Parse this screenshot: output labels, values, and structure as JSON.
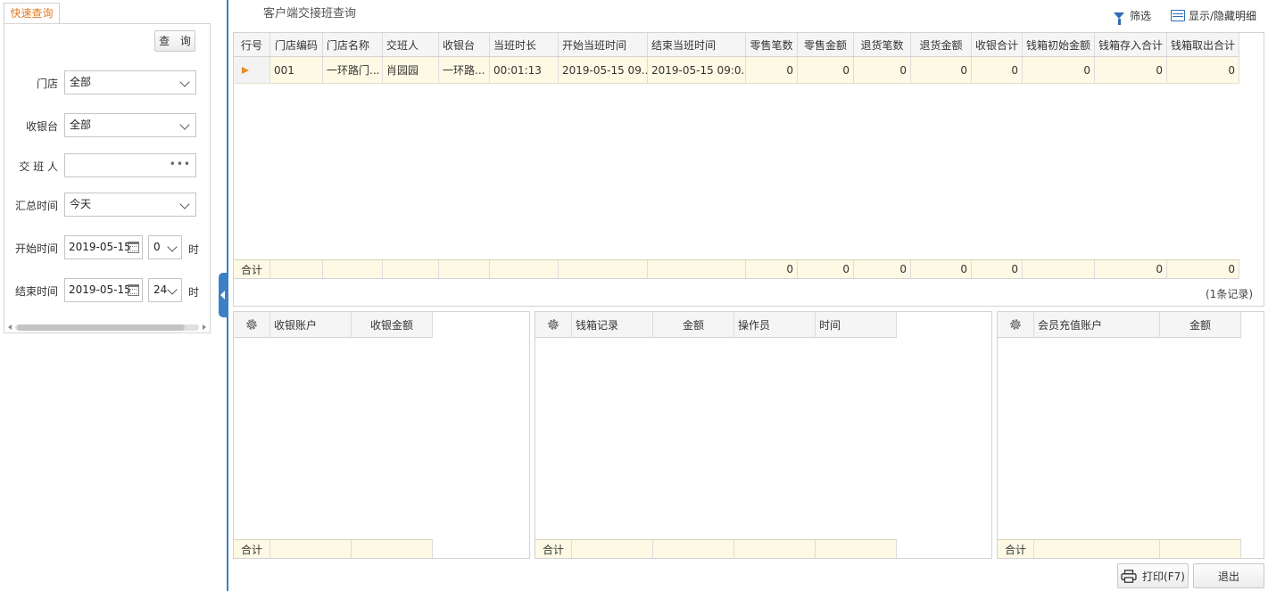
{
  "quick_query": {
    "tab_label": "快速查询",
    "query_button": "查 询",
    "store": {
      "label": "门店",
      "value": "全部"
    },
    "register": {
      "label": "收银台",
      "value": "全部"
    },
    "handover_person": {
      "label": "交 班 人",
      "value": ""
    },
    "summary_time": {
      "label": "汇总时间",
      "value": "今天"
    },
    "start_time": {
      "label": "开始时间",
      "date": "2019-05-15",
      "hour": "0",
      "unit": "时"
    },
    "end_time": {
      "label": "结束时间",
      "date": "2019-05-15",
      "hour": "24",
      "unit": "时"
    }
  },
  "header": {
    "title": "客户端交接班查询",
    "filter_label": "筛选",
    "toggle_label": "显示/隐藏明细"
  },
  "main_grid": {
    "columns": [
      "行号",
      "门店编码",
      "门店名称",
      "交班人",
      "收银台",
      "当班时长",
      "开始当班时间",
      "结束当班时间",
      "零售笔数",
      "零售金额",
      "退货笔数",
      "退货金额",
      "收银合计",
      "钱箱初始金额",
      "钱箱存入合计",
      "钱箱取出合计"
    ],
    "rows": [
      [
        "",
        "001",
        "一环路门...",
        "肖园园",
        "一环路...",
        "00:01:13",
        "2019-05-15 09...",
        "2019-05-15 09:0...",
        "0",
        "0",
        "0",
        "0",
        "0",
        "0",
        "0",
        "0"
      ]
    ],
    "summary": {
      "label": "合计",
      "values": [
        "",
        "",
        "",
        "",
        "",
        "",
        "",
        "0",
        "0",
        "0",
        "0",
        "0",
        "",
        "0",
        "0"
      ]
    },
    "record_count": "(1条记录)"
  },
  "cash_account_grid": {
    "columns": [
      "收银账户",
      "收银金额"
    ],
    "summary_label": "合计"
  },
  "cashbox_grid": {
    "columns": [
      "钱箱记录",
      "金额",
      "操作员",
      "时间"
    ],
    "summary_label": "合计"
  },
  "member_grid": {
    "columns": [
      "会员充值账户",
      "金额"
    ],
    "summary_label": "合计"
  },
  "footer": {
    "print_label": "打印(F7)",
    "exit_label": "退出"
  }
}
